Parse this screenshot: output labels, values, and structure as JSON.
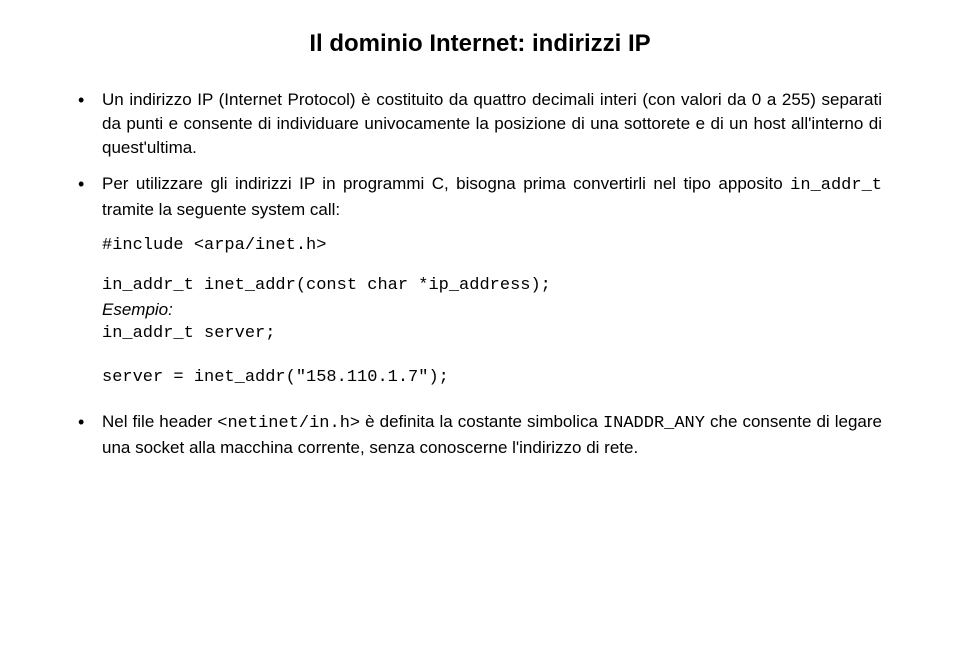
{
  "title": "Il dominio Internet: indirizzi IP",
  "items": [
    {
      "text": "Un indirizzo IP (Internet Protocol) è costituito da quattro decimali interi (con valori da 0 a 255) separati da punti e consente di individuare univocamente la posizione di una sottorete e di un host all'interno di quest'ultima."
    },
    {
      "pre": "Per utilizzare gli indirizzi IP in programmi C, bisogna prima convertirli nel tipo apposito ",
      "code1": "in_addr_t",
      "post": " tramite la seguente system call:",
      "include": "#include <arpa/inet.h>",
      "proto": "in_addr_t inet_addr(const char *ip_address);",
      "example_label": "Esempio:",
      "decl": "in_addr_t server;",
      "assign": "server = inet_addr(\"158.110.1.7\");"
    },
    {
      "pre": "Nel file header ",
      "code1": "<netinet/in.h>",
      "mid": " è definita la costante simbolica ",
      "code2": "INADDR_ANY",
      "post": " che consente di legare una socket alla macchina corrente, senza conoscerne l'indirizzo di rete."
    }
  ]
}
